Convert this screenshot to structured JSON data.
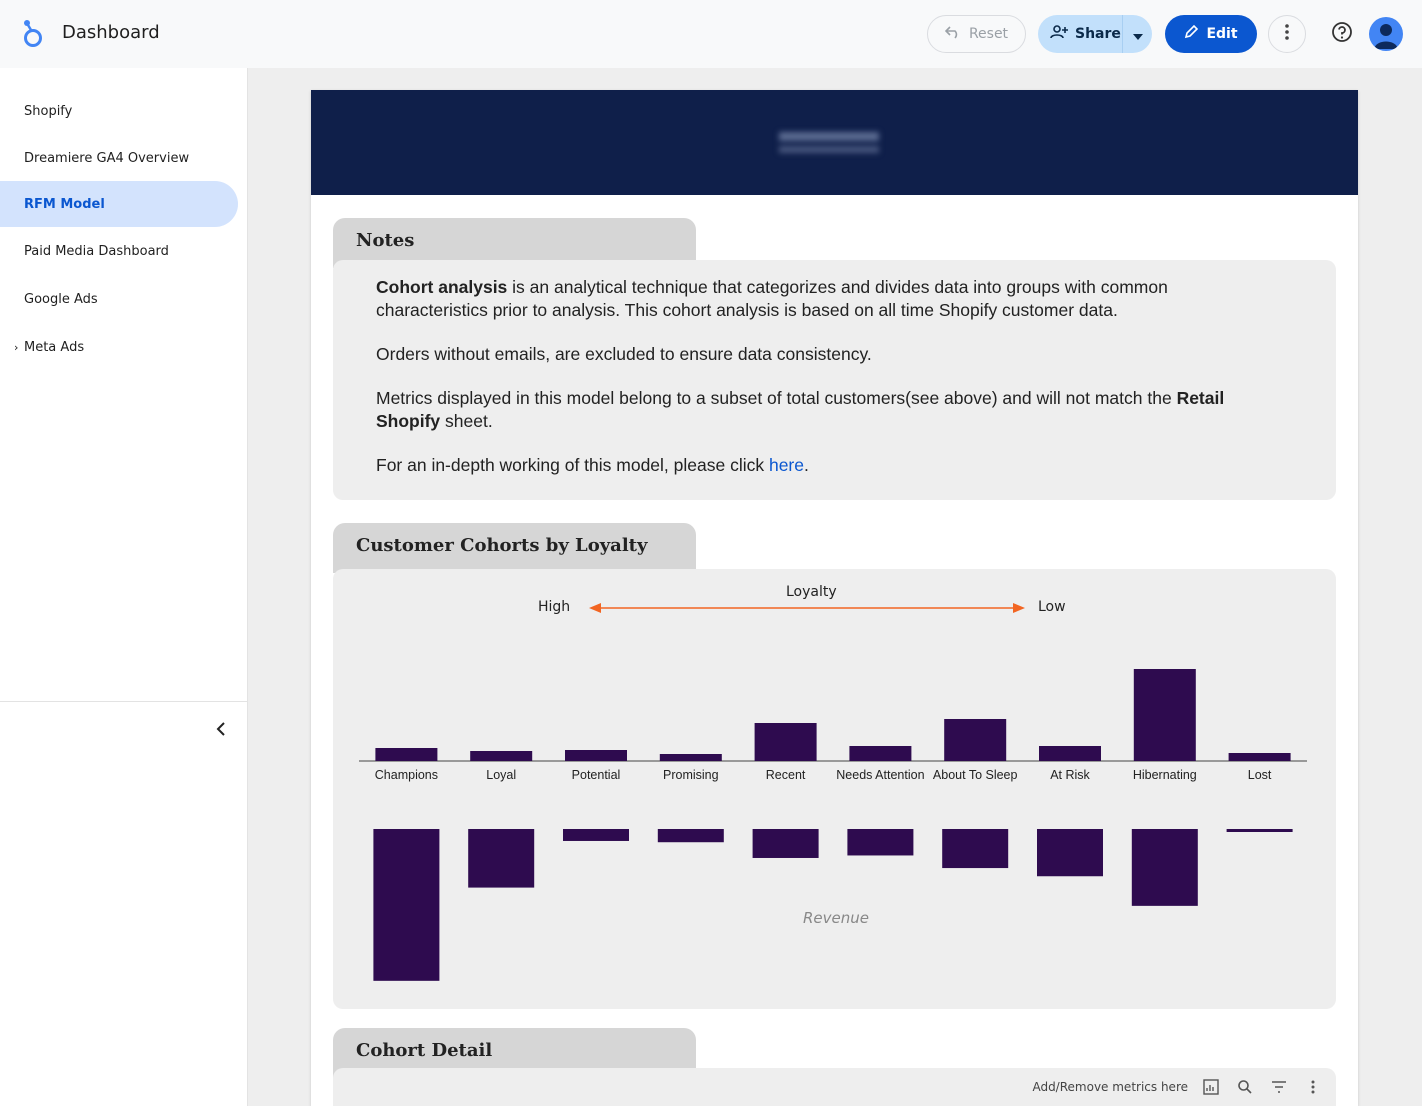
{
  "header": {
    "title": "Dashboard",
    "reset_label": "Reset",
    "share_label": "Share",
    "edit_label": "Edit"
  },
  "sidebar": {
    "items": [
      {
        "label": "Shopify"
      },
      {
        "label": "Dreamiere GA4 Overview"
      },
      {
        "label": "RFM Model"
      },
      {
        "label": "Paid Media Dashboard"
      },
      {
        "label": "Google Ads"
      },
      {
        "label": "Meta Ads"
      }
    ],
    "active_index": 2
  },
  "notes": {
    "tab_title": "Notes",
    "p1_bold": "Cohort analysis",
    "p1_rest": " is an analytical technique that categorizes and divides data into groups with common characteristics prior to analysis. This cohort analysis is based on all time Shopify customer data.",
    "p2": "Orders without emails, are excluded to ensure data consistency.",
    "p3_start": "Metrics displayed in this model belong to a subset of total customers(see above) and will not match the ",
    "p3_bold": "Retail Shopify",
    "p3_end": " sheet.",
    "p4_start": "For an in-depth working of this model, please click ",
    "p4_link": "here",
    "p4_end": "."
  },
  "cohorts": {
    "tab_title": "Customer Cohorts by Loyalty",
    "axis_title": "Loyalty",
    "high_label": "High",
    "low_label": "Low",
    "revenue_label": "Revenue"
  },
  "detail": {
    "tab_title": "Cohort Detail",
    "metrics_hint": "Add/Remove metrics here"
  },
  "colors": {
    "bar": "#2e0b4f",
    "arrow": "#f26522",
    "banner": "#0f1f4a",
    "accent": "#0b57d0"
  },
  "chart_data": {
    "type": "bar",
    "categories": [
      "Champions",
      "Loyal",
      "Potential",
      "Promising",
      "Recent",
      "Needs Attention",
      "About To Sleep",
      "At Risk",
      "Hibernating",
      "Lost"
    ],
    "series": [
      {
        "values": [
          1.3,
          1.0,
          1.1,
          0.7,
          3.8,
          1.5,
          4.2,
          1.5,
          9.2,
          0.8
        ]
      },
      {
        "values": [
          24.1,
          9.3,
          1.9,
          2.1,
          4.6,
          4.2,
          6.2,
          7.5,
          12.2,
          0.3
        ]
      }
    ]
  }
}
